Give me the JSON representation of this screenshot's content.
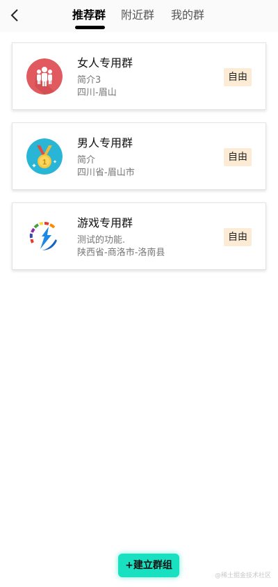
{
  "header": {
    "back_icon": "chevron-left-icon",
    "tabs": [
      {
        "label": "推荐群",
        "active": true
      },
      {
        "label": "附近群",
        "active": false
      },
      {
        "label": "我的群",
        "active": false
      }
    ]
  },
  "groups": [
    {
      "name": "女人专用群",
      "intro": "简介3",
      "location": "四川-眉山",
      "badge": "自由",
      "icon": "people-group-icon",
      "icon_color": "#e05a5f"
    },
    {
      "name": "男人专用群",
      "intro": "简介",
      "location": "四川省-眉山市",
      "badge": "自由",
      "icon": "medal-icon",
      "icon_color": "#29b6d6"
    },
    {
      "name": "游戏专用群",
      "intro": "测试的功能.",
      "location": "陕西省-商洛市-洛南县",
      "badge": "自由",
      "icon": "lightning-logo-icon",
      "icon_color": "#1e88e5"
    }
  ],
  "create_button": {
    "label": "+建立群组",
    "color": "#18e0c0"
  },
  "watermark": "@稀土掘金技术社区"
}
